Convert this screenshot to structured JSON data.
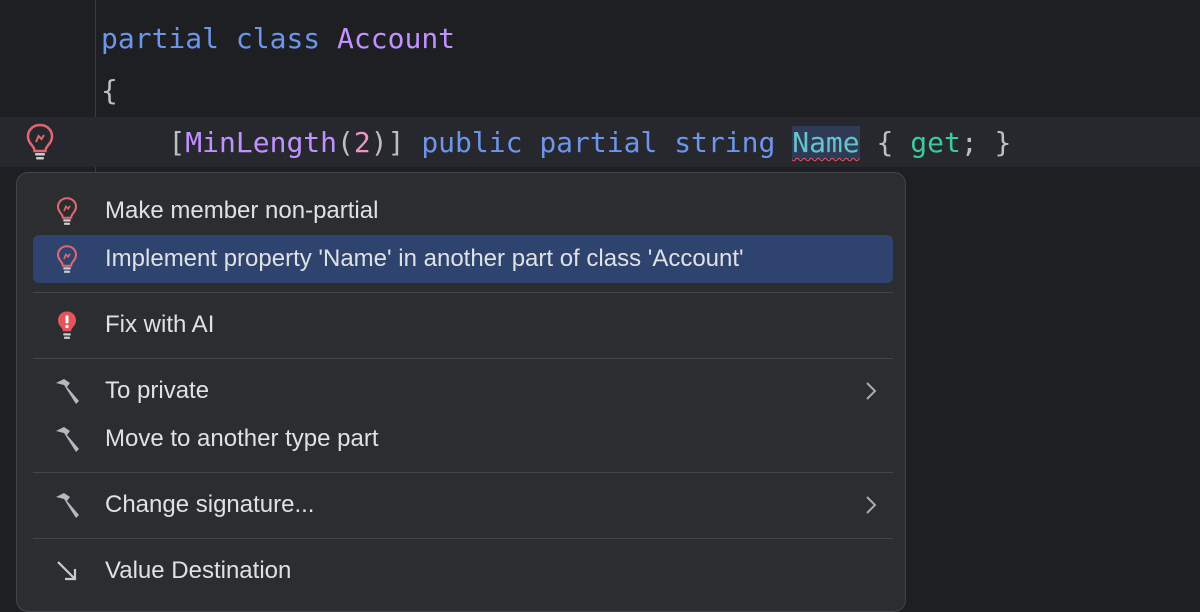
{
  "editor": {
    "line1": {
      "kw_partial": "partial",
      "kw_class": "class",
      "class_name": "Account"
    },
    "line2": {
      "brace": "{"
    },
    "line3": {
      "bracket_open": "[",
      "attribute": "MinLength",
      "paren_open": "(",
      "arg": "2",
      "paren_close_bracket": ")]",
      "kw_public": "public",
      "kw_partial": "partial",
      "kw_string": "string",
      "property_name": "Name",
      "brace_open": "{",
      "accessor": "get",
      "semicolon": ";",
      "brace_close": "}"
    }
  },
  "colors": {
    "background": "#1e1f22",
    "popup_background": "#2b2d30",
    "selection": "#2e436e",
    "keyword": "#6c95eb",
    "class_name": "#c191ff",
    "number": "#ed94c0",
    "property": "#66c3cc",
    "accessor": "#39cc9b",
    "error": "#f75464"
  },
  "gutter": {
    "icon": "bulb-error-icon"
  },
  "popup": {
    "items": [
      {
        "label": "Make member non-partial",
        "icon": "bulb-error-icon",
        "selected": false,
        "submenu": false
      },
      {
        "label": "Implement property 'Name' in another part of class 'Account'",
        "icon": "bulb-error-icon",
        "selected": true,
        "submenu": false
      },
      {
        "label": "Fix with AI",
        "icon": "ai-fix-icon",
        "selected": false,
        "submenu": false
      },
      {
        "label": "To private",
        "icon": "hammer-icon",
        "selected": false,
        "submenu": true
      },
      {
        "label": "Move to another type part",
        "icon": "hammer-icon",
        "selected": false,
        "submenu": false
      },
      {
        "label": "Change signature...",
        "icon": "hammer-icon",
        "selected": false,
        "submenu": true
      },
      {
        "label": "Value Destination",
        "icon": "arrow-down-right-icon",
        "selected": false,
        "submenu": false
      }
    ]
  }
}
